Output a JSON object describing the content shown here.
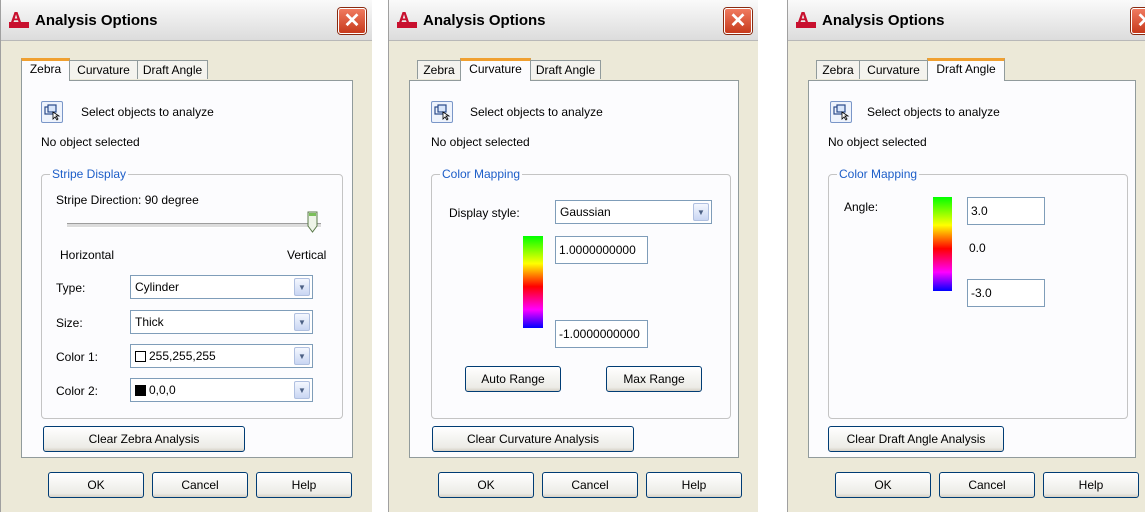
{
  "dialogs": [
    {
      "title": "Analysis Options",
      "tabs": [
        "Zebra",
        "Curvature",
        "Draft Angle"
      ],
      "active_tab": "Zebra",
      "select_label": "Select objects to analyze",
      "status": "No object selected",
      "group_title": "Stripe Display",
      "stripe_direction": "Stripe Direction: 90 degree",
      "slider_value_degrees": 90,
      "slider_left_label": "Horizontal",
      "slider_right_label": "Vertical",
      "type_label": "Type:",
      "type_value": "Cylinder",
      "size_label": "Size:",
      "size_value": "Thick",
      "color1_label": "Color 1:",
      "color1_value": "255,255,255",
      "color1_swatch": "#ffffff",
      "color2_label": "Color 2:",
      "color2_value": "0,0,0",
      "color2_swatch": "#000000",
      "clear_button": "Clear Zebra Analysis",
      "ok": "OK",
      "cancel": "Cancel",
      "help": "Help"
    },
    {
      "title": "Analysis Options",
      "tabs": [
        "Zebra",
        "Curvature",
        "Draft Angle"
      ],
      "active_tab": "Curvature",
      "select_label": "Select objects to analyze",
      "status": "No object selected",
      "group_title": "Color Mapping",
      "display_style_label": "Display style:",
      "display_style_value": "Gaussian",
      "max_value": "1.0000000000",
      "min_value": "-1.0000000000",
      "auto_range": "Auto Range",
      "max_range": "Max Range",
      "clear_button": "Clear Curvature Analysis",
      "ok": "OK",
      "cancel": "Cancel",
      "help": "Help"
    },
    {
      "title": "Analysis Options",
      "tabs": [
        "Zebra",
        "Curvature",
        "Draft Angle"
      ],
      "active_tab": "Draft Angle",
      "select_label": "Select objects to analyze",
      "status": "No object selected",
      "group_title": "Color Mapping",
      "angle_label": "Angle:",
      "max_value": "3.0",
      "mid_value": "0.0",
      "min_value": "-3.0",
      "clear_button": "Clear Draft Angle Analysis",
      "ok": "OK",
      "cancel": "Cancel",
      "help": "Help"
    }
  ],
  "colors": {
    "dialog_bg": "#ece9d8",
    "panel_bg": "#fcfcfe",
    "group_title": "#1d5ec8",
    "tab_highlight": "#f0a030",
    "close_button": "#c73a1c"
  }
}
